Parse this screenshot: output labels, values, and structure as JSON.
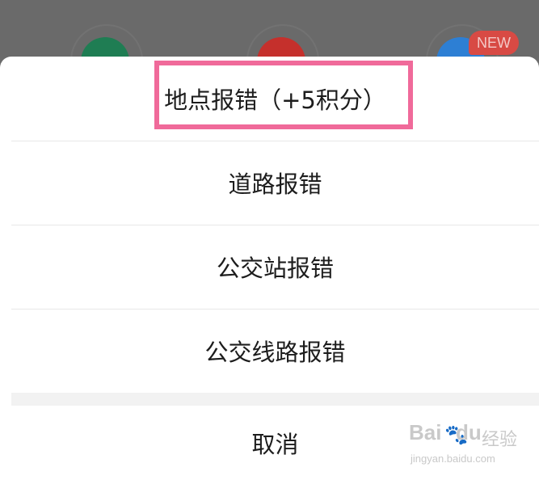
{
  "background": {
    "new_badge": "NEW"
  },
  "menu": {
    "items": [
      {
        "label": "地点报错（+5积分）"
      },
      {
        "label": "道路报错"
      },
      {
        "label": "公交站报错"
      },
      {
        "label": "公交线路报错"
      }
    ],
    "cancel_label": "取消"
  },
  "colors": {
    "highlight": "#f06a9a",
    "overlay": "#6b6b6b"
  },
  "watermark": {
    "logo": "Bai",
    "logo_suffix": "du",
    "brand_cn": "经验",
    "url": "jingyan.baidu.com"
  }
}
